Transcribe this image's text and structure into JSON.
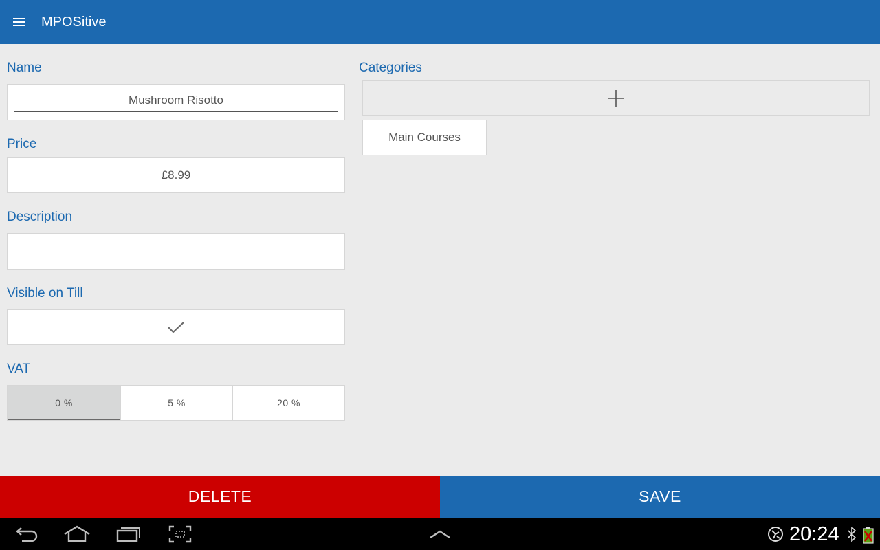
{
  "appbar": {
    "title": "MPOSitive",
    "menu_icon": "hamburger-menu-icon"
  },
  "form": {
    "name": {
      "label": "Name",
      "value": "Mushroom Risotto"
    },
    "price": {
      "label": "Price",
      "value": "£8.99"
    },
    "description": {
      "label": "Description",
      "value": ""
    },
    "visible": {
      "label": "Visible on Till",
      "checked": true,
      "icon": "checkmark-icon"
    },
    "vat": {
      "label": "VAT",
      "options": [
        "0 %",
        "5 %",
        "20 %"
      ],
      "selected": "0 %"
    }
  },
  "categories": {
    "label": "Categories",
    "add_icon": "plus-icon",
    "items": [
      "Main Courses"
    ]
  },
  "actions": {
    "delete_label": "DELETE",
    "save_label": "SAVE"
  },
  "system_bar": {
    "time": "20:24",
    "icons": [
      "back-icon",
      "home-icon",
      "recent-apps-icon",
      "screenshot-icon",
      "up-chevron-icon",
      "network-icon",
      "bluetooth-icon",
      "battery-icon"
    ]
  },
  "colors": {
    "primary": "#1c69b0",
    "danger": "#cc0000",
    "background": "#ebebeb"
  }
}
